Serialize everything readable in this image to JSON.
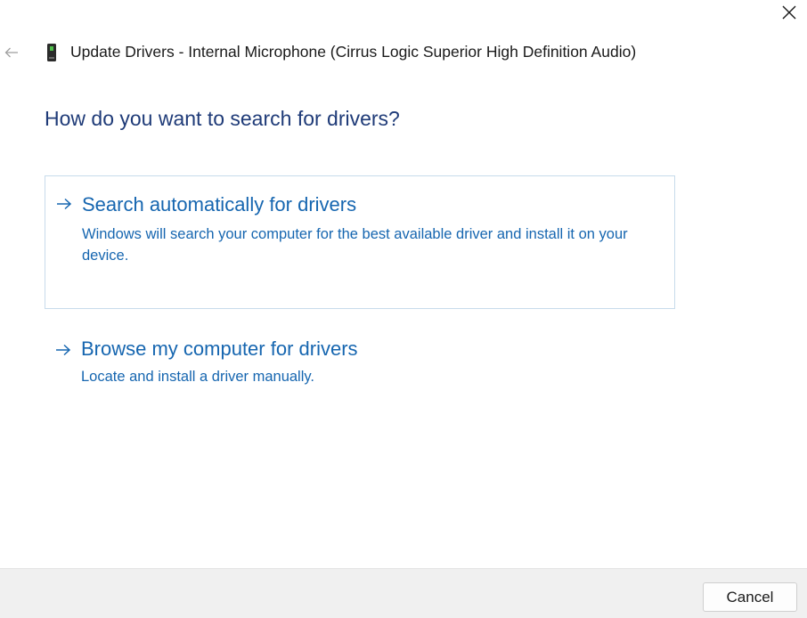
{
  "window": {
    "title": "Update Drivers - Internal Microphone (Cirrus Logic Superior High Definition Audio)",
    "close_icon": "close-icon",
    "back_icon": "back-arrow-icon",
    "device_icon": "microphone-device-icon"
  },
  "main": {
    "heading": "How do you want to search for drivers?",
    "options": [
      {
        "title": "Search automatically for drivers",
        "description": "Windows will search your computer for the best available driver and install it on your device.",
        "icon": "arrow-right-icon",
        "selected": true
      },
      {
        "title": "Browse my computer for drivers",
        "description": "Locate and install a driver manually.",
        "icon": "arrow-right-icon",
        "selected": false
      }
    ]
  },
  "footer": {
    "cancel_label": "Cancel"
  },
  "colors": {
    "heading": "#1f3b78",
    "link": "#1666b0",
    "footer_bg": "#f0f0f0",
    "selection_border": "#c7dbeb"
  }
}
